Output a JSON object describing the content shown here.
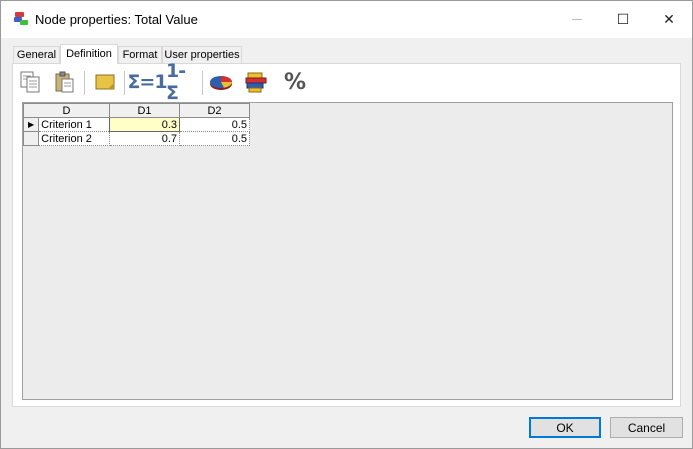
{
  "window": {
    "title": "Node properties: Total Value",
    "controls": {
      "minimize": "—",
      "maximize": "☐",
      "close": "✕"
    }
  },
  "tabs": [
    {
      "label": "General",
      "active": false
    },
    {
      "label": "Definition",
      "active": true
    },
    {
      "label": "Format",
      "active": false
    },
    {
      "label": "User properties",
      "active": false
    }
  ],
  "toolbar": {
    "sum_to_one": "Σ=1",
    "one_minus_sum": "1-Σ",
    "percent": "%"
  },
  "table": {
    "corner_header": "D",
    "columns": [
      "D1",
      "D2"
    ],
    "rows": [
      {
        "indicator": "▶",
        "label": "Criterion 1",
        "values": [
          "0.3",
          "0.5"
        ]
      },
      {
        "indicator": "",
        "label": "Criterion 2",
        "values": [
          "0.7",
          "0.5"
        ]
      }
    ]
  },
  "buttons": {
    "ok": "OK",
    "cancel": "Cancel"
  },
  "colors": {
    "accent": "#0078d7",
    "selected_cell": "#ffffc8"
  }
}
